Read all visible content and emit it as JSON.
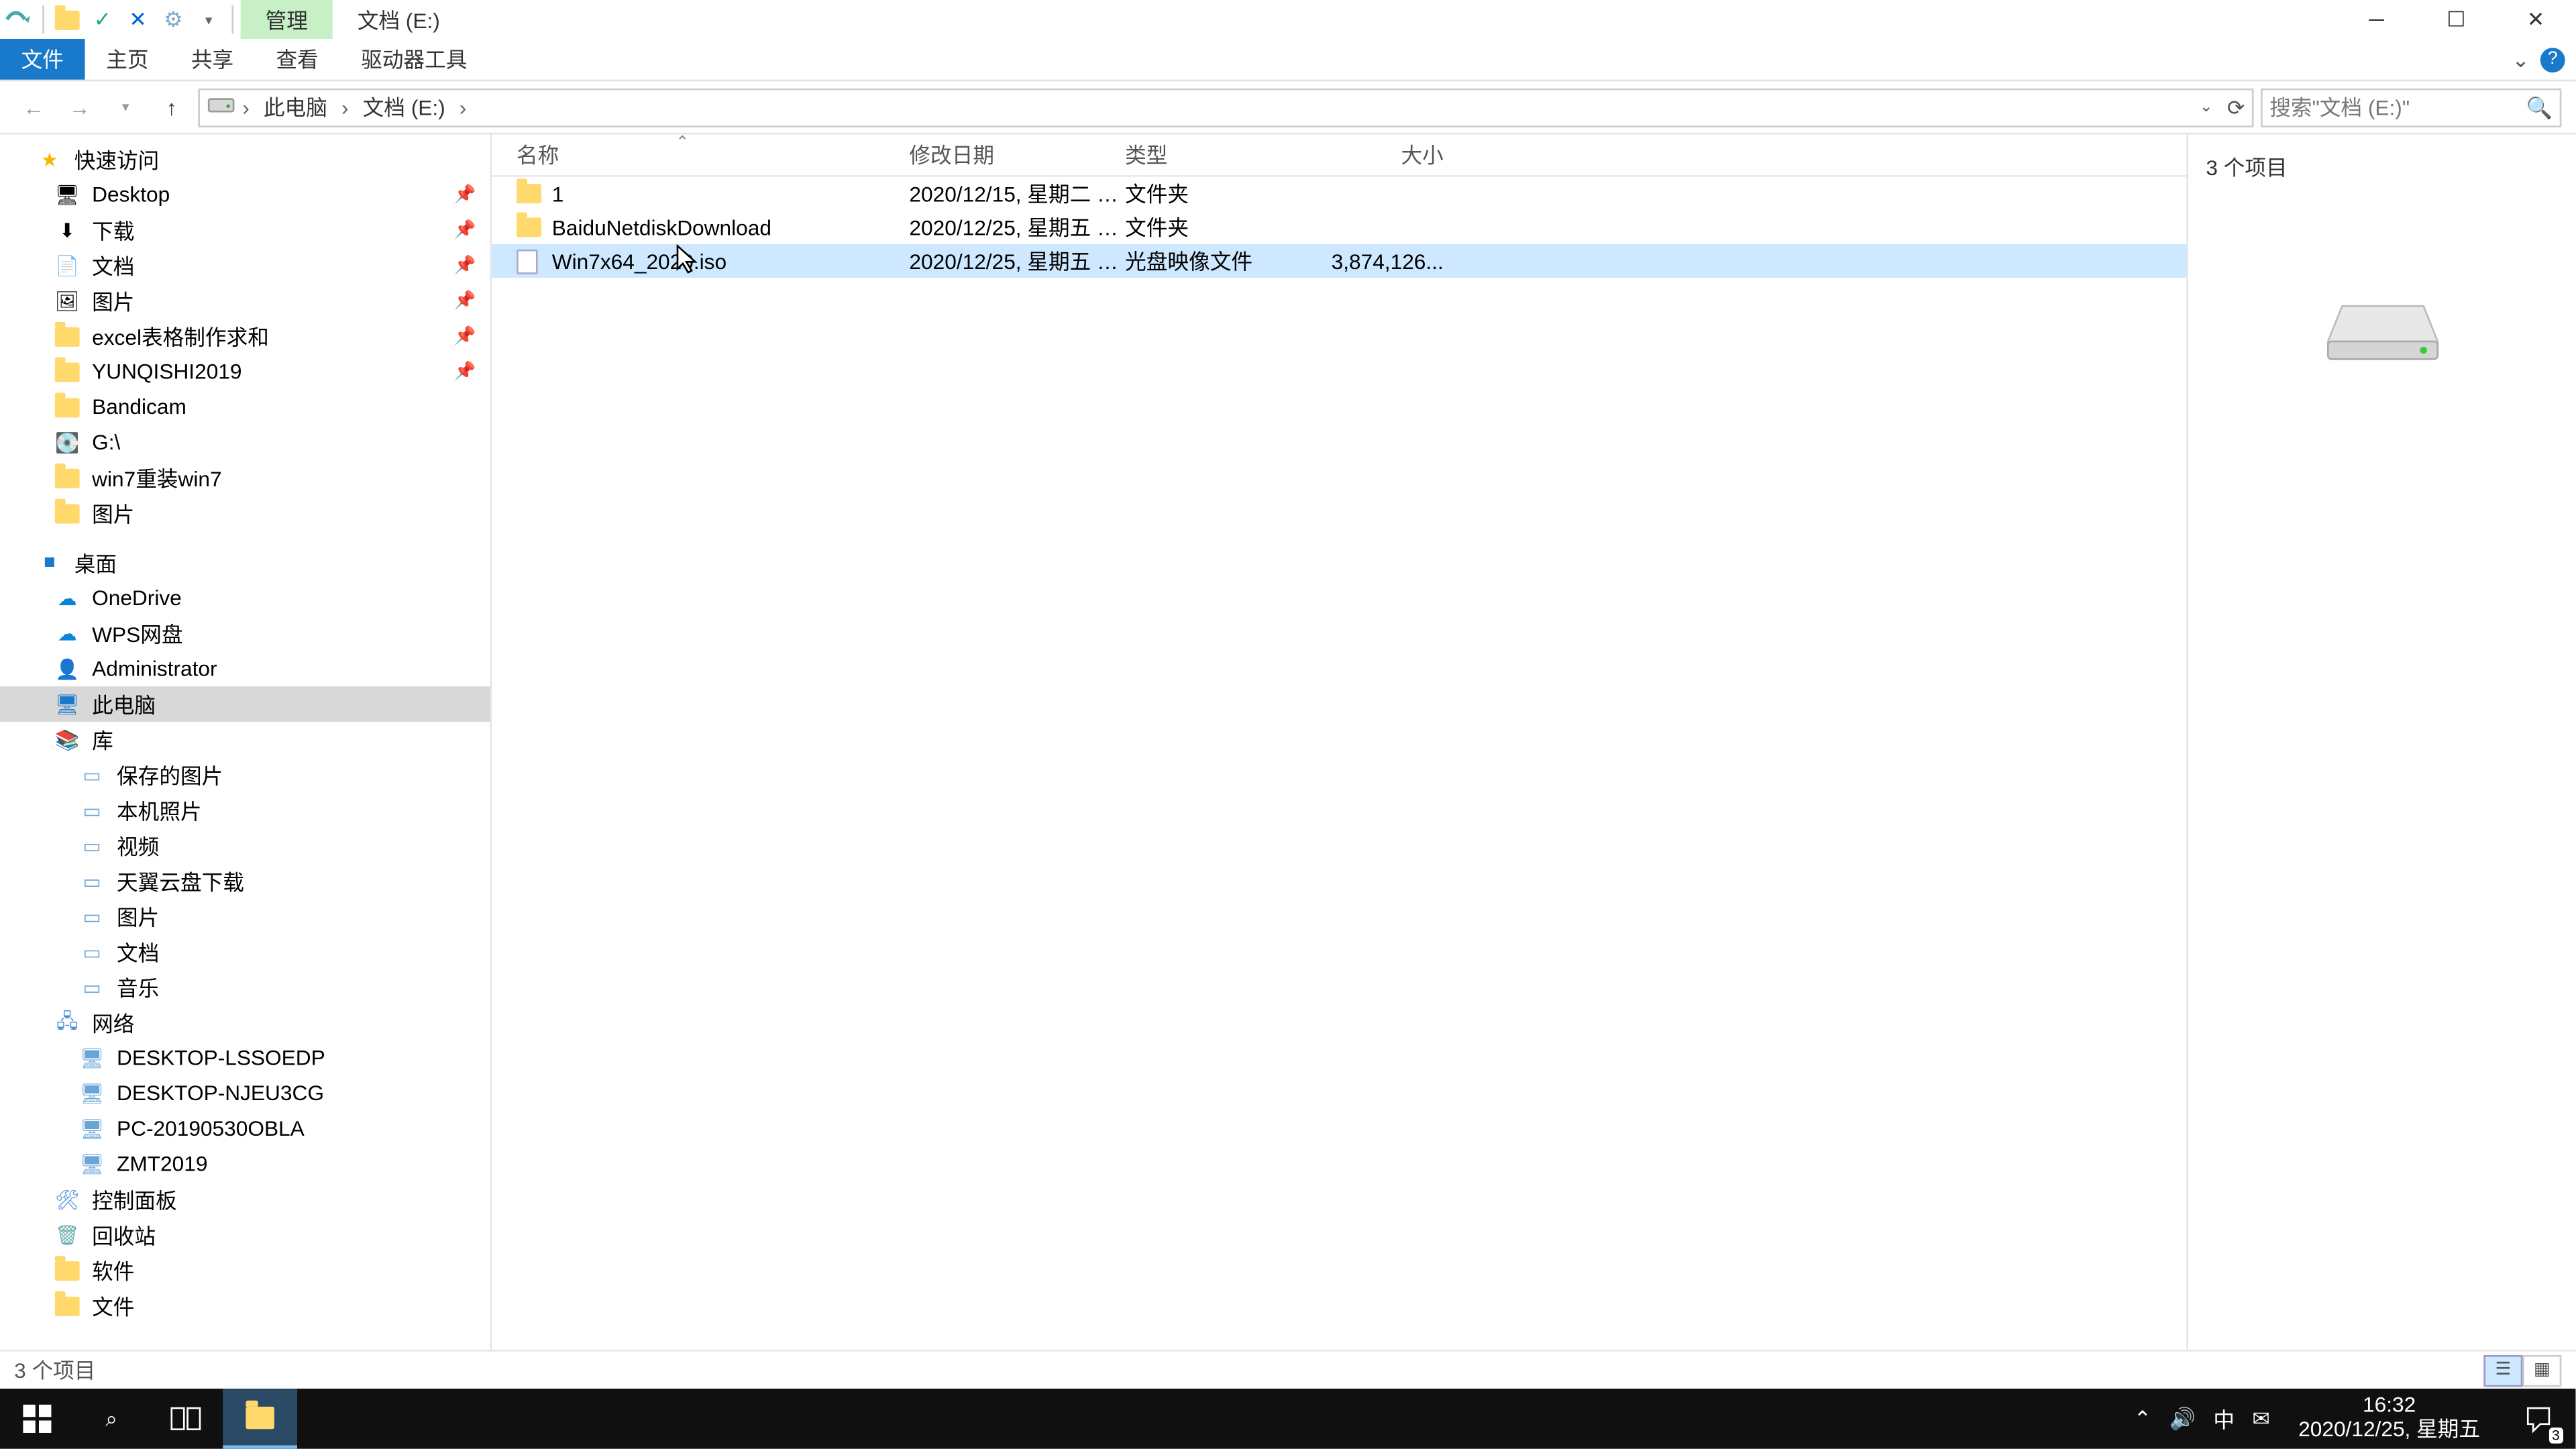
{
  "title_ctx_tab": "管理",
  "title_location": "文档 (E:)",
  "ribbon": {
    "file": "文件",
    "home": "主页",
    "share": "共享",
    "view": "查看",
    "drive": "驱动器工具"
  },
  "breadcrumbs": {
    "root": "此电脑",
    "drive": "文档 (E:)"
  },
  "search_placeholder": "搜索\"文档 (E:)\"",
  "nav": {
    "quick_access": "快速访问",
    "qa_items": [
      {
        "label": "Desktop",
        "icon": "desktop"
      },
      {
        "label": "下载",
        "icon": "downloads"
      },
      {
        "label": "文档",
        "icon": "documents"
      },
      {
        "label": "图片",
        "icon": "pictures"
      },
      {
        "label": "excel表格制作求和",
        "icon": "folder"
      },
      {
        "label": "YUNQISHI2019",
        "icon": "folder"
      },
      {
        "label": "Bandicam",
        "icon": "folder"
      },
      {
        "label": "G:\\",
        "icon": "drive"
      },
      {
        "label": "win7重装win7",
        "icon": "folder"
      },
      {
        "label": "图片",
        "icon": "folder"
      }
    ],
    "desktop": "桌面",
    "onedrive": "OneDrive",
    "wps": "WPS网盘",
    "admin": "Administrator",
    "thispc": "此电脑",
    "libraries": "库",
    "lib_items": [
      "保存的图片",
      "本机照片",
      "视频",
      "天翼云盘下载",
      "图片",
      "文档",
      "音乐"
    ],
    "network": "网络",
    "net_items": [
      "DESKTOP-LSSOEDP",
      "DESKTOP-NJEU3CG",
      "PC-20190530OBLA",
      "ZMT2019"
    ],
    "control_panel": "控制面板",
    "recycle": "回收站",
    "soft": "软件",
    "files": "文件"
  },
  "columns": {
    "name": "名称",
    "date": "修改日期",
    "type": "类型",
    "size": "大小"
  },
  "rows": [
    {
      "icon": "folder",
      "name": "1",
      "date": "2020/12/15, 星期二 1...",
      "type": "文件夹",
      "size": ""
    },
    {
      "icon": "folder",
      "name": "BaiduNetdiskDownload",
      "date": "2020/12/25, 星期五 1...",
      "type": "文件夹",
      "size": ""
    },
    {
      "icon": "iso",
      "name": "Win7x64_2020.iso",
      "date": "2020/12/25, 星期五 1...",
      "type": "光盘映像文件",
      "size": "3,874,126...",
      "selected": true
    }
  ],
  "preview_summary": "3 个项目",
  "status_text": "3 个项目",
  "clock": {
    "time": "16:32",
    "date": "2020/12/25, 星期五"
  },
  "notif_count": "3",
  "ime": "中"
}
